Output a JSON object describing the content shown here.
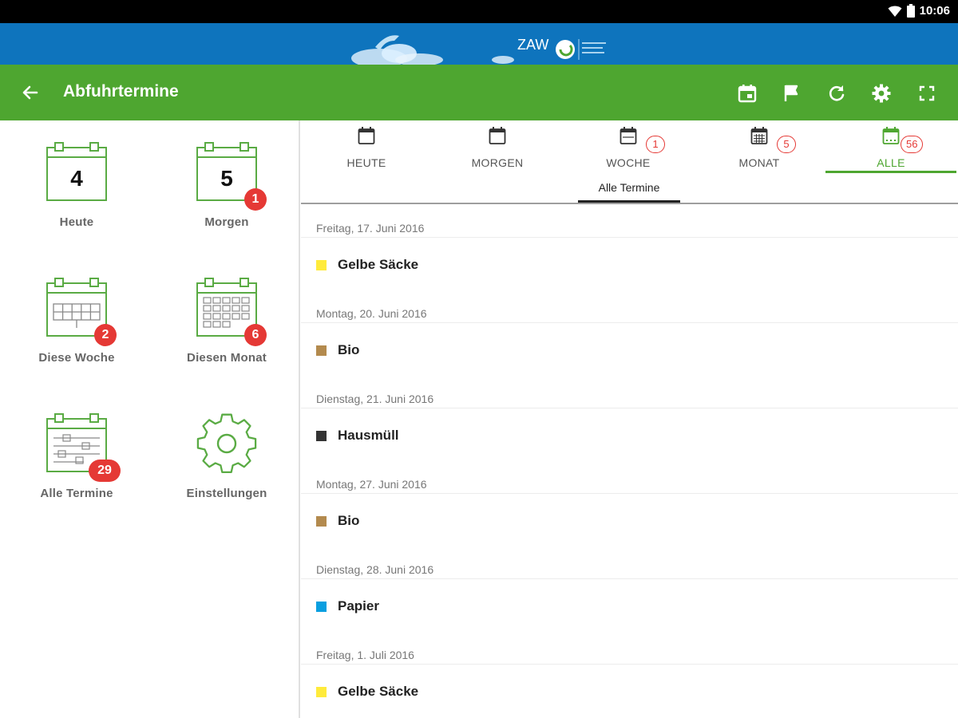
{
  "colors": {
    "toolbar_green": "#4ea630",
    "banner_blue": "#0e74bd",
    "badge_red": "#e53935",
    "icon_green": "#5aab44"
  },
  "statusbar": {
    "time": "10:06",
    "icons": [
      "wifi-icon",
      "battery-icon"
    ]
  },
  "banner": {
    "logo_text": "ZAW"
  },
  "toolbar": {
    "title": "Abfuhrtermine",
    "actions": [
      "calendar-event-icon",
      "flag-icon",
      "refresh-icon",
      "settings-icon",
      "fullscreen-icon"
    ]
  },
  "sidebar": {
    "tiles": [
      {
        "label": "Heute",
        "day": "4",
        "badge": ""
      },
      {
        "label": "Morgen",
        "day": "5",
        "badge": "1"
      },
      {
        "label": "Diese Woche",
        "badge": "2"
      },
      {
        "label": "Diesen Monat",
        "badge": "6"
      },
      {
        "label": "Alle Termine",
        "badge": "29"
      },
      {
        "label": "Einstellungen",
        "badge": ""
      }
    ]
  },
  "tabs": [
    {
      "label": "HEUTE",
      "badge": ""
    },
    {
      "label": "MORGEN",
      "badge": ""
    },
    {
      "label": "WOCHE",
      "badge": "1"
    },
    {
      "label": "MONAT",
      "badge": "5"
    },
    {
      "label": "ALLE",
      "badge": "56",
      "active": true
    }
  ],
  "subtab": {
    "label": "Alle Termine"
  },
  "entries": [
    {
      "date": "Freitag, 17. Juni 2016",
      "name": "Gelbe Säcke",
      "color": "#ffeb3b"
    },
    {
      "date": "Montag, 20. Juni 2016",
      "name": "Bio",
      "color": "#b38a4e"
    },
    {
      "date": "Dienstag, 21. Juni 2016",
      "name": "Hausmüll",
      "color": "#333333"
    },
    {
      "date": "Montag, 27. Juni 2016",
      "name": "Bio",
      "color": "#b38a4e"
    },
    {
      "date": "Dienstag, 28. Juni 2016",
      "name": "Papier",
      "color": "#0a9fe0"
    },
    {
      "date": "Freitag, 1. Juli 2016",
      "name": "Gelbe Säcke",
      "color": "#ffeb3b"
    }
  ]
}
